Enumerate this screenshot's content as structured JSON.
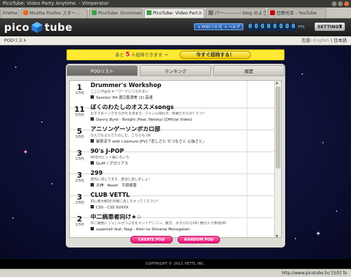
{
  "window": {
    "title": "PicoTube: Video Party Anytime. - Vimperator"
  },
  "tabs": [
    {
      "label": "Firefox",
      "icon_color": "#e86a1a"
    },
    {
      "label": "Mozilla Firefox スター...",
      "icon_color": "#e86a1a"
    },
    {
      "label": "PicoTube: Drummer's...",
      "icon_color": "#3aa04a"
    },
    {
      "label": "PicoTube: Video Part...",
      "icon_color": "#3aa04a"
    },
    {
      "label": "パー----------- blog のよう...",
      "icon_color": "#777777"
    },
    {
      "label": "日野光幸 - YouTube",
      "icon_color": "#cc0000"
    }
  ],
  "header": {
    "logo_left": "pico",
    "logo_right": "tube",
    "pod_list_btn": "+ PODリスト",
    "help_btn": "+ ヘルプ",
    "points_digits": [
      "0",
      "0",
      "0",
      "0",
      "0",
      "0",
      "0",
      "0"
    ],
    "points_unit": "PTS",
    "settings_label": "SETTINGS"
  },
  "subheader": {
    "breadcrumb": "PODリスト",
    "lang_label": "言語:",
    "lang_en": "English",
    "lang_sep": "|",
    "lang_ja": "日本語"
  },
  "invite": {
    "prefix": "あと",
    "count": "5",
    "suffix": "人招待できます →",
    "button": "今すぐ招待する！"
  },
  "panel_tabs": [
    "PODリスト",
    "ランキング",
    "履歴"
  ],
  "pods": [
    {
      "count": "1",
      "cap": "1/5PJ",
      "title": "Drummer's Workshop",
      "desc": "ここに作品をキーワードにつられまい",
      "now": "Session '84 渡辺香津美 (2) 高速"
    },
    {
      "count": "11",
      "cap": "5/5PJ",
      "title": "ぼくのわたしのオススメsongs",
      "desc": "おすすめソングをながれる流ます。ジャンル問わず。体験だからの？どう？",
      "now": "Danny Byrd - Tonight (Feat. Netsky) [Official Video]"
    },
    {
      "count": "5",
      "cap": "3/5PJ",
      "title": "アニソンゲーソンボカロ部",
      "desc": "なんでもよんでたのしむ。こちらも OK",
      "now": "篠原涼子 with t.komuro [PV]「恋しさと せつなさと 心強さと」"
    },
    {
      "count": "3",
      "cap": "1/5PJ",
      "title": "90's J-POP",
      "desc": "90年代ヒット曲いろいろ",
      "now": "GLAY / グロリアス"
    },
    {
      "count": "3",
      "cap": "2/5PJ",
      "title": "299",
      "desc": "適当に流してます。適当に流しましょ!",
      "now": "大神　Reset　平原綾香"
    },
    {
      "count": "3",
      "cap": "2/5PJ",
      "title": "CLUB VETTL",
      "desc": "初心者大歓迎!日曜に流しちゃってください!",
      "now": "CSS - CSS SUXXX"
    },
    {
      "count": "2",
      "cap": "1/5PJ",
      "title": "中二病患者向け★☆",
      "desc": "中二病気にっ  ̄γ | ルがつぶるをメントアニソン、東方、ボカロならOK! 敷が入り参加OK!",
      "now": "supercell feat. Nagi - Kimi no Shiranai Monogatari"
    }
  ],
  "buttons": {
    "create": "CREATE POD",
    "random": "RANDOM POD"
  },
  "footer": {
    "copyright": "COPYRIGHT © 2011 VETTL INC."
  },
  "statusbar": {
    "url": "http://www.picotube.tv/ [3/5] To"
  },
  "colors": {
    "invite_yellow": "#ffe933",
    "accent_pink": "#e8137a",
    "counter_cyan": "#6fd0ff"
  }
}
